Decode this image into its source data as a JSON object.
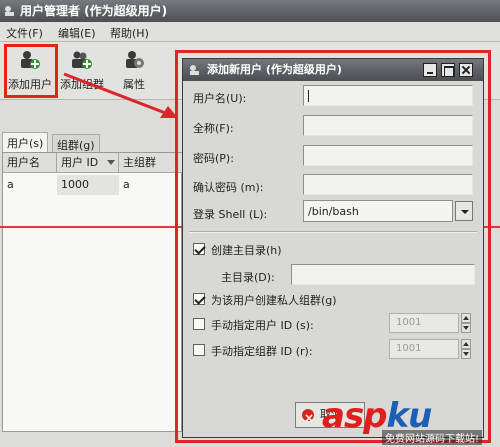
{
  "main_window": {
    "title": "用户管理者 (作为超级用户)",
    "menu": [
      {
        "label": "文件(F)"
      },
      {
        "label": "编辑(E)"
      },
      {
        "label": "帮助(H)"
      }
    ],
    "toolbar": [
      {
        "label": "添加用户"
      },
      {
        "label": "添加组群"
      },
      {
        "label": "属性"
      }
    ],
    "tabs": [
      {
        "label": "用户(s)"
      },
      {
        "label": "组群(g)"
      }
    ],
    "table": {
      "columns": [
        "用户名",
        "用户 ID",
        "主组群"
      ],
      "rows": [
        {
          "username": "a",
          "uid": "1000",
          "group": "a"
        }
      ]
    }
  },
  "dialog": {
    "title": "添加新用户 (作为超级用户)",
    "fields": {
      "username_label": "用户名(U):",
      "fullname_label": "全称(F):",
      "password_label": "密码(P):",
      "confirm_label": "确认密码 (m):",
      "shell_label": "登录 Shell (L):",
      "shell_value": "/bin/bash"
    },
    "create_home_label": "创建主目录(h)",
    "home_dir_label": "主目录(D):",
    "private_group_label": "为该用户创建私人组群(g)",
    "manual_uid_label": "手动指定用户 ID (s):",
    "manual_uid_value": "1001",
    "manual_gid_label": "手动指定组群 ID (r):",
    "manual_gid_value": "1001",
    "cancel_label": "取消"
  },
  "watermark": {
    "logo_a": "asp",
    "logo_b": "ku",
    "tagline": "免费网站源码下载站!"
  }
}
